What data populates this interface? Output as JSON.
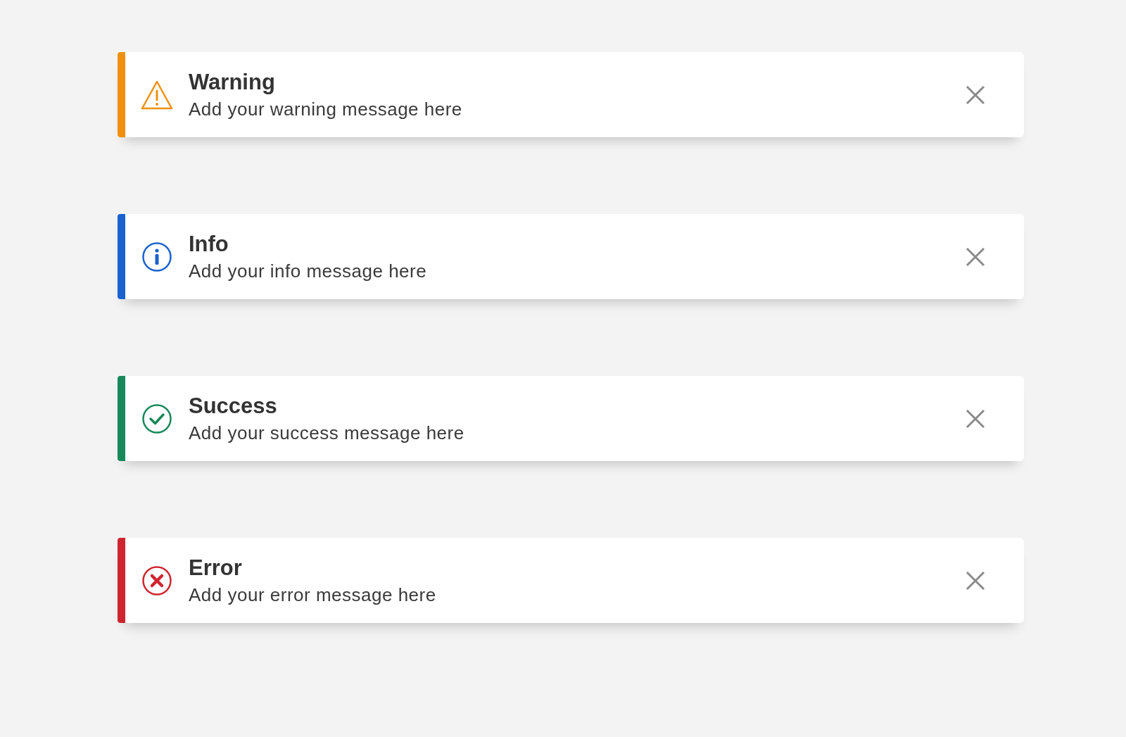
{
  "alerts": [
    {
      "kind": "warning",
      "title": "Warning",
      "message": "Add your warning message here",
      "color": "#f0900f"
    },
    {
      "kind": "info",
      "title": "Info",
      "message": "Add your info message here",
      "color": "#1a62d0"
    },
    {
      "kind": "success",
      "title": "Success",
      "message": "Add your success message here",
      "color": "#17885a"
    },
    {
      "kind": "error",
      "title": "Error",
      "message": "Add your error message here",
      "color": "#cf2530"
    }
  ]
}
